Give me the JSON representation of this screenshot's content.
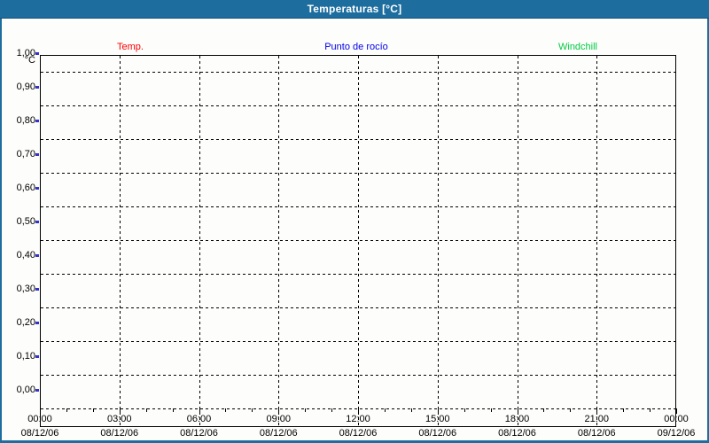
{
  "window": {
    "title": "Temperaturas [°C]"
  },
  "legend": {
    "items": [
      {
        "id": "temp",
        "label": "Temp.",
        "color": "#ff0000"
      },
      {
        "id": "dew-point",
        "label": "Punto de rocío",
        "color": "#0000ee"
      },
      {
        "id": "windchill",
        "label": "Windchill",
        "color": "#00cc44"
      }
    ]
  },
  "chart_data": {
    "type": "line",
    "title": "Temperaturas [°C]",
    "xlabel": "",
    "ylabel": "°C",
    "ylim": [
      0.0,
      1.0
    ],
    "y_tick_step": 0.1,
    "y_tick_labels": [
      "1,00",
      "0,90",
      "0,80",
      "0,70",
      "0,60",
      "0,50",
      "0,40",
      "0,30",
      "0,20",
      "0,10",
      "0,00"
    ],
    "grid": "dashed",
    "legend_position": "top",
    "x_axis": {
      "span_hours": 24,
      "major_tick_interval_hours": 3,
      "minor_tick_interval_hours": 1,
      "ticks": [
        {
          "hour": 0,
          "time": "00:00",
          "date": "08/12/06"
        },
        {
          "hour": 3,
          "time": "03:00",
          "date": "08/12/06"
        },
        {
          "hour": 6,
          "time": "06:00",
          "date": "08/12/06"
        },
        {
          "hour": 9,
          "time": "09:00",
          "date": "08/12/06"
        },
        {
          "hour": 12,
          "time": "12:00",
          "date": "08/12/06"
        },
        {
          "hour": 15,
          "time": "15:00",
          "date": "08/12/06"
        },
        {
          "hour": 18,
          "time": "18:00",
          "date": "08/12/06"
        },
        {
          "hour": 21,
          "time": "21:00",
          "date": "08/12/06"
        },
        {
          "hour": 24,
          "time": "00:00",
          "date": "09/12/06"
        }
      ]
    },
    "series": [
      {
        "name": "Temp.",
        "color": "#ff0000",
        "values": []
      },
      {
        "name": "Punto de rocío",
        "color": "#0000ee",
        "values": []
      },
      {
        "name": "Windchill",
        "color": "#00cc44",
        "values": []
      }
    ]
  },
  "colors": {
    "titlebar": "#1d6d9e",
    "panel": "#fdfdfb",
    "grid": "#000000",
    "y_tick_marker": "#3333cc"
  }
}
